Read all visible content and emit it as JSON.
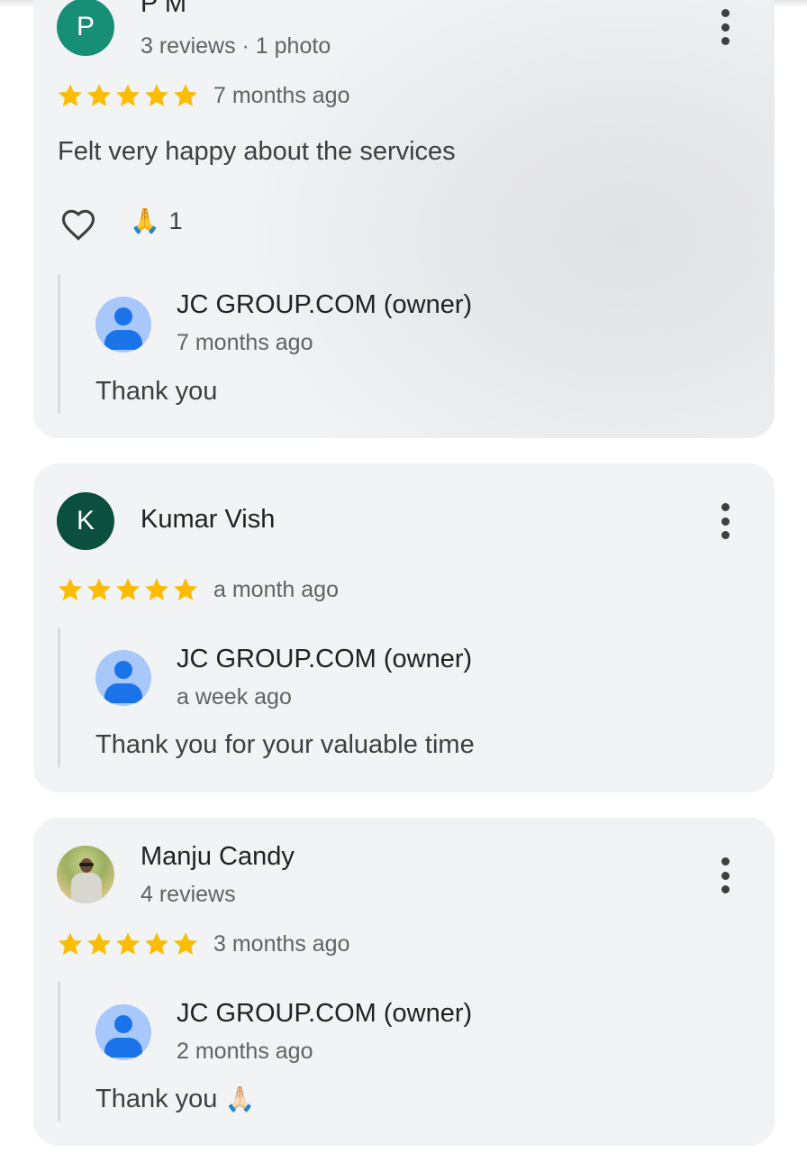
{
  "reviews": [
    {
      "author": "P M",
      "avatar_letter": "P",
      "avatar_color": "#178f77",
      "meta": "3 reviews · 1 photo",
      "rating": 5,
      "time": "7 months ago",
      "text": "Felt very happy about the services",
      "reaction_emoji": "🙏",
      "reaction_count": "1",
      "owner_reply": {
        "name": "JC GROUP.COM (owner)",
        "time": "7 months ago",
        "text": "Thank you"
      }
    },
    {
      "author": "Kumar Vish",
      "avatar_letter": "K",
      "avatar_color": "#0b4f3e",
      "rating": 5,
      "time": "a month ago",
      "owner_reply": {
        "name": "JC GROUP.COM (owner)",
        "time": "a week ago",
        "text": "Thank you for your valuable time"
      }
    },
    {
      "author": "Manju Candy",
      "meta": "4 reviews",
      "rating": 5,
      "time": "3 months ago",
      "owner_reply": {
        "name": "JC GROUP.COM (owner)",
        "time": "2 months ago",
        "text": "Thank you",
        "emoji": "🙏🏻"
      }
    }
  ],
  "colors": {
    "star": "#fbbc04",
    "card_bg": "#f2f3f5",
    "owner_avatar": "#a8c7fa"
  },
  "icons": {
    "more": "more-vert-icon",
    "like": "heart-outline-icon",
    "star": "star-icon",
    "owner_avatar": "account-circle-icon"
  }
}
